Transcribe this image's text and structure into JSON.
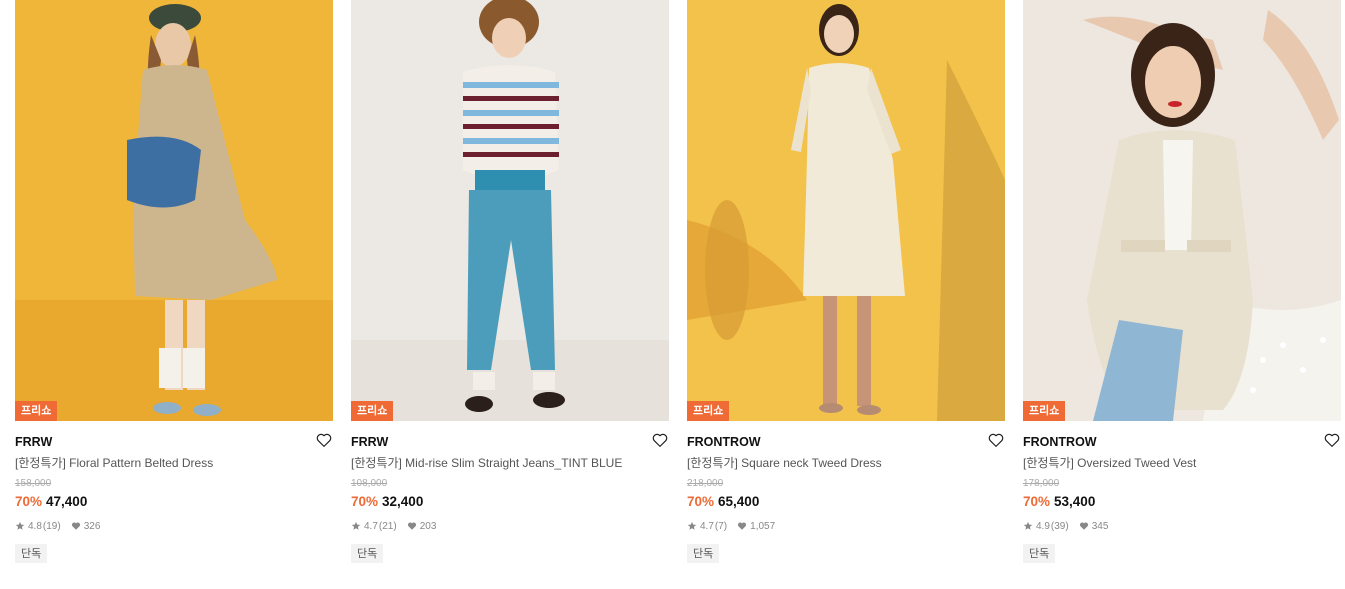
{
  "products": [
    {
      "badge": "프리쇼",
      "brand": "FRRW",
      "title": "[한정특가] Floral Pattern Belted Dress",
      "original_price": "158,000",
      "discount": "70%",
      "price": "47,400",
      "rating": "4.8",
      "review_count": "(19)",
      "likes": "326",
      "tag": "단독",
      "image_bg": "#efb63a"
    },
    {
      "badge": "프리쇼",
      "brand": "FRRW",
      "title": "[한정특가] Mid-rise Slim Straight Jeans_TINT BLUE",
      "original_price": "108,000",
      "discount": "70%",
      "price": "32,400",
      "rating": "4.7",
      "review_count": "(21)",
      "likes": "203",
      "tag": "단독",
      "image_bg": "#ece8e3"
    },
    {
      "badge": "프리쇼",
      "brand": "FRONTROW",
      "title": "[한정특가] Square neck Tweed Dress",
      "original_price": "218,000",
      "discount": "70%",
      "price": "65,400",
      "rating": "4.7",
      "review_count": "(7)",
      "likes": "1,057",
      "tag": "단독",
      "image_bg": "#f3c24a"
    },
    {
      "badge": "프리쇼",
      "brand": "FRONTROW",
      "title": "[한정특가] Oversized Tweed Vest",
      "original_price": "178,000",
      "discount": "70%",
      "price": "53,400",
      "rating": "4.9",
      "review_count": "(39)",
      "likes": "345",
      "tag": "단독",
      "image_bg": "#ede7e0"
    }
  ],
  "icons": {
    "wishlist": "heart-outline-icon",
    "rating": "star-icon",
    "likes": "heart-filled-icon"
  },
  "colors": {
    "accent": "#f06a36",
    "text": "#111111",
    "muted": "#888888",
    "strike": "#aaaaaa",
    "tag_bg": "#f2f2f2"
  }
}
